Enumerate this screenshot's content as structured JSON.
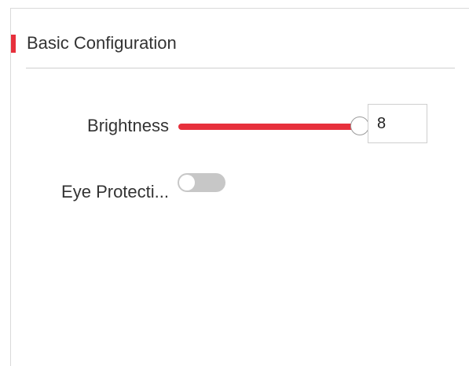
{
  "section": {
    "title": "Basic Configuration",
    "accent_color": "#e7303c"
  },
  "brightness": {
    "label": "Brightness",
    "value": "8",
    "slider_fraction": 1.0
  },
  "eye_protection": {
    "label": "Eye Protecti...",
    "enabled": false
  }
}
